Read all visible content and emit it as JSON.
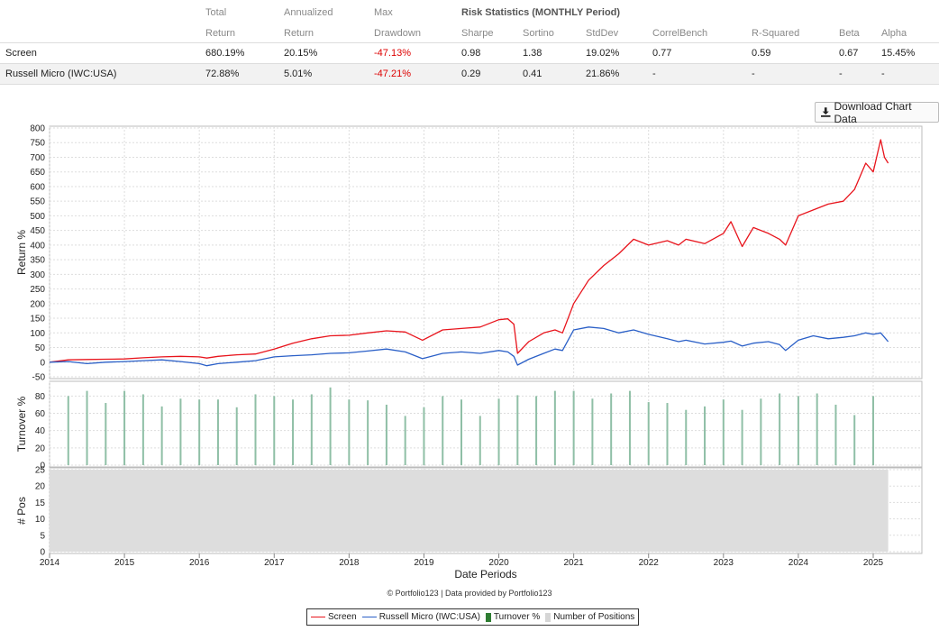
{
  "stats_table": {
    "header_top": [
      "",
      "Total",
      "Annualized",
      "Max",
      "Risk Statistics (MONTHLY Period)"
    ],
    "header_bottom": [
      "",
      "Return",
      "Return",
      "Drawdown",
      "Sharpe",
      "Sortino",
      "StdDev",
      "CorrelBench",
      "R-Squared",
      "Beta",
      "Alpha"
    ],
    "rows": [
      {
        "name": "Screen",
        "total_return": "680.19%",
        "annualized_return": "20.15%",
        "max_drawdown": "-47.13%",
        "sharpe": "0.98",
        "sortino": "1.38",
        "stddev": "19.02%",
        "correl_bench": "0.77",
        "r_squared": "0.59",
        "beta": "0.67",
        "alpha": "15.45%"
      },
      {
        "name": "Russell Micro (IWC:USA)",
        "total_return": "72.88%",
        "annualized_return": "5.01%",
        "max_drawdown": "-47.21%",
        "sharpe": "0.29",
        "sortino": "0.41",
        "stddev": "21.86%",
        "correl_bench": "-",
        "r_squared": "-",
        "beta": "-",
        "alpha": "-"
      }
    ]
  },
  "download_button": {
    "label": "Download Chart Data",
    "icon": "download-icon"
  },
  "credit": "© Portfolio123 | Data provided by Portfolio123",
  "colors": {
    "screen": "#e8141c",
    "benchmark": "#2a5fc7",
    "turnover": "#8fbfa6",
    "positions": "#dddddd",
    "negative": "#dd0000"
  },
  "chart_data": [
    {
      "type": "line",
      "ylabel": "Return %",
      "ylim": [
        -50,
        800
      ],
      "yticks": [
        800,
        750,
        700,
        650,
        600,
        550,
        500,
        450,
        400,
        350,
        300,
        250,
        200,
        150,
        100,
        50,
        0,
        -50
      ],
      "grid": true,
      "series": [
        {
          "name": "Screen",
          "color": "#e8141c",
          "x": [
            2014.0,
            2014.25,
            2014.5,
            2014.75,
            2015.0,
            2015.25,
            2015.5,
            2015.75,
            2016.0,
            2016.1,
            2016.25,
            2016.5,
            2016.75,
            2017.0,
            2017.25,
            2017.5,
            2017.75,
            2018.0,
            2018.25,
            2018.5,
            2018.75,
            2018.98,
            2019.25,
            2019.5,
            2019.75,
            2020.0,
            2020.12,
            2020.2,
            2020.25,
            2020.4,
            2020.6,
            2020.75,
            2020.85,
            2021.0,
            2021.2,
            2021.4,
            2021.6,
            2021.8,
            2022.0,
            2022.25,
            2022.4,
            2022.5,
            2022.75,
            2023.0,
            2023.1,
            2023.25,
            2023.4,
            2023.6,
            2023.75,
            2023.83,
            2024.0,
            2024.2,
            2024.4,
            2024.6,
            2024.75,
            2024.9,
            2025.0,
            2025.1,
            2025.15,
            2025.2
          ],
          "y": [
            0,
            8,
            9,
            10,
            11,
            15,
            18,
            20,
            18,
            14,
            20,
            25,
            28,
            45,
            65,
            80,
            90,
            92,
            100,
            107,
            103,
            75,
            110,
            115,
            120,
            145,
            148,
            130,
            30,
            70,
            100,
            110,
            100,
            200,
            280,
            330,
            370,
            420,
            400,
            415,
            400,
            420,
            405,
            440,
            480,
            395,
            460,
            440,
            420,
            400,
            500,
            520,
            540,
            550,
            590,
            680,
            650,
            760,
            700,
            680
          ]
        },
        {
          "name": "Russell Micro (IWC:USA)",
          "color": "#2a5fc7",
          "x": [
            2014.0,
            2014.25,
            2014.5,
            2014.75,
            2015.0,
            2015.25,
            2015.5,
            2015.75,
            2016.0,
            2016.1,
            2016.25,
            2016.5,
            2016.75,
            2017.0,
            2017.25,
            2017.5,
            2017.75,
            2018.0,
            2018.25,
            2018.5,
            2018.75,
            2018.98,
            2019.25,
            2019.5,
            2019.75,
            2020.0,
            2020.12,
            2020.2,
            2020.25,
            2020.4,
            2020.6,
            2020.75,
            2020.85,
            2021.0,
            2021.2,
            2021.4,
            2021.6,
            2021.8,
            2022.0,
            2022.25,
            2022.4,
            2022.5,
            2022.75,
            2023.0,
            2023.1,
            2023.25,
            2023.4,
            2023.6,
            2023.75,
            2023.83,
            2024.0,
            2024.2,
            2024.4,
            2024.6,
            2024.75,
            2024.9,
            2025.0,
            2025.1,
            2025.15,
            2025.2
          ],
          "y": [
            0,
            2,
            -5,
            0,
            2,
            5,
            8,
            2,
            -5,
            -12,
            -5,
            0,
            5,
            18,
            22,
            25,
            30,
            32,
            38,
            45,
            35,
            12,
            30,
            35,
            30,
            40,
            35,
            20,
            -10,
            10,
            30,
            45,
            40,
            110,
            120,
            115,
            100,
            110,
            95,
            80,
            70,
            75,
            62,
            68,
            72,
            55,
            65,
            70,
            60,
            40,
            75,
            90,
            80,
            85,
            90,
            100,
            95,
            100,
            85,
            70
          ]
        }
      ]
    },
    {
      "type": "bar",
      "ylabel": "Turnover %",
      "ylim": [
        0,
        95
      ],
      "yticks": [
        80,
        60,
        40,
        20,
        0
      ],
      "series": [
        {
          "name": "Turnover %",
          "color": "#8fbfa6",
          "x": [
            2014.25,
            2014.5,
            2014.75,
            2015.0,
            2015.25,
            2015.5,
            2015.75,
            2016.0,
            2016.25,
            2016.5,
            2016.75,
            2017.0,
            2017.25,
            2017.5,
            2017.75,
            2018.0,
            2018.25,
            2018.5,
            2018.75,
            2019.0,
            2019.25,
            2019.5,
            2019.75,
            2020.0,
            2020.25,
            2020.5,
            2020.75,
            2021.0,
            2021.25,
            2021.5,
            2021.75,
            2022.0,
            2022.25,
            2022.5,
            2022.75,
            2023.0,
            2023.25,
            2023.5,
            2023.75,
            2024.0,
            2024.25,
            2024.5,
            2024.75,
            2025.0
          ],
          "values": [
            80,
            86,
            72,
            86,
            82,
            68,
            77,
            76,
            76,
            67,
            82,
            80,
            76,
            82,
            90,
            76,
            75,
            70,
            57,
            67,
            80,
            76,
            57,
            77,
            81,
            80,
            86,
            86,
            77,
            83,
            86,
            73,
            72,
            64,
            68,
            76,
            64,
            77,
            83,
            80,
            83,
            70,
            58,
            80
          ]
        }
      ]
    },
    {
      "type": "area",
      "ylabel": "# Pos",
      "ylim": [
        0,
        25
      ],
      "yticks": [
        25,
        20,
        15,
        10,
        5,
        0
      ],
      "series": [
        {
          "name": "Number of Positions",
          "color": "#dddddd",
          "x": [
            2014.0,
            2025.2
          ],
          "y": [
            25,
            25
          ]
        }
      ],
      "xlabel": "Date Periods",
      "xticks": [
        "2014",
        "2015",
        "2016",
        "2017",
        "2018",
        "2019",
        "2020",
        "2021",
        "2022",
        "2023",
        "2024",
        "2025"
      ]
    }
  ]
}
